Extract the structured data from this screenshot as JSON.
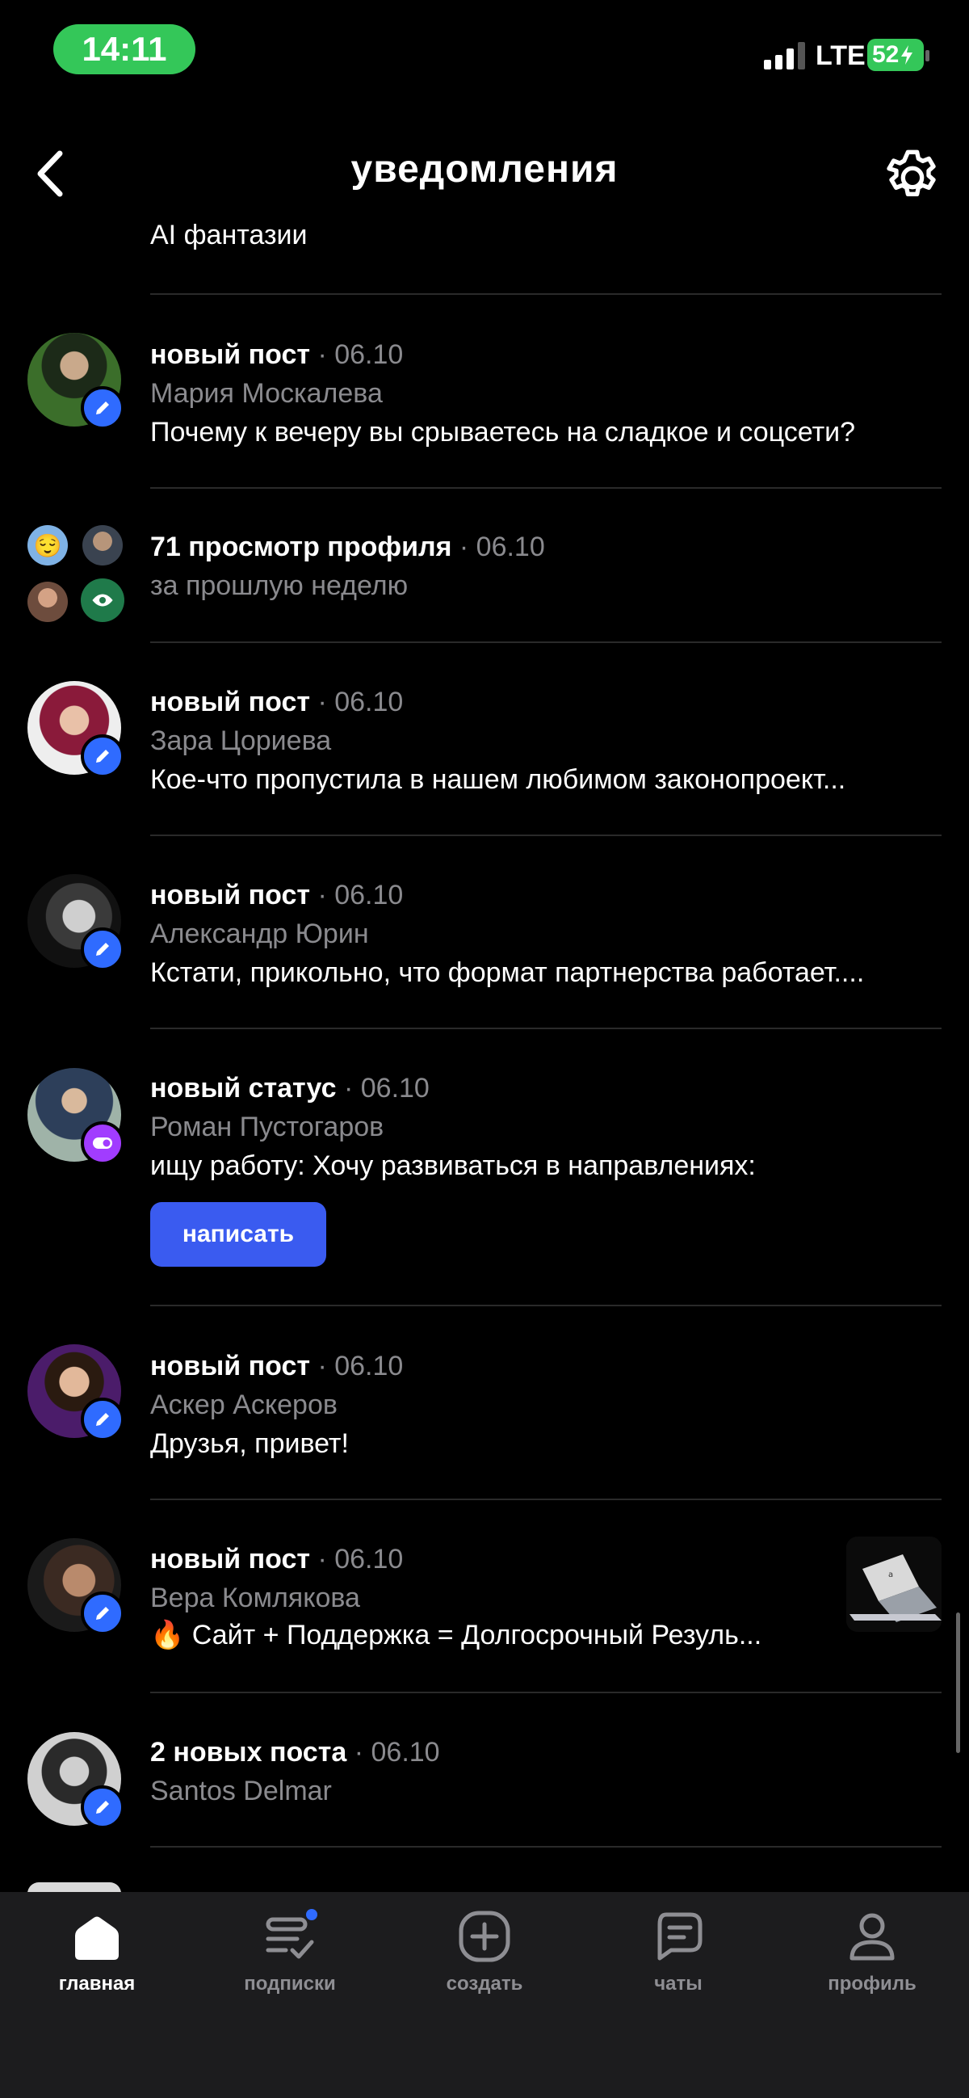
{
  "status_bar": {
    "time": "14:11",
    "network": "LTE",
    "battery": "52"
  },
  "header": {
    "title": "уведомления"
  },
  "cut_item": {
    "text": "AI  фантазии"
  },
  "items": [
    {
      "type": "новый пост",
      "date": "06.10",
      "name": "Мария Москалева",
      "text": "Почему к вечеру вы срываетесь на сладкое и соцсети?",
      "badge_icon": "pencil-icon"
    },
    {
      "type": "71 просмотр профиля",
      "date": "06.10",
      "name": "за прошлую неделю",
      "badge_icon": "eye-icon"
    },
    {
      "type": "новый пост",
      "date": "06.10",
      "name": "Зара Цориева",
      "text": "Кое-что пропустила в нашем любимом законопроект...",
      "badge_icon": "pencil-icon"
    },
    {
      "type": "новый пост",
      "date": "06.10",
      "name": "Александр Юрин",
      "text": "Кстати, прикольно, что формат партнерства работает....",
      "badge_icon": "pencil-icon"
    },
    {
      "type": "новый статус",
      "date": "06.10",
      "name": "Роман Пустогаров",
      "text": "ищу работу: Хочу развиваться в направлениях:",
      "badge_icon": "status-icon",
      "button": "написать"
    },
    {
      "type": "новый пост",
      "date": "06.10",
      "name": "Аскер Аскеров",
      "text": "Друзья, привет!",
      "badge_icon": "pencil-icon"
    },
    {
      "type": "новый пост",
      "date": "06.10",
      "name": "Вера Комлякова",
      "text": "Сайт + Поддержка = Долгосрочный Резуль...",
      "emoji": "🔥",
      "badge_icon": "pencil-icon"
    },
    {
      "type": "2 новых поста",
      "date": "06.10",
      "name": "Santos Delmar",
      "badge_icon": "pencil-icon"
    }
  ],
  "tabs": [
    {
      "label": "главная",
      "icon": "home-icon",
      "active": true
    },
    {
      "label": "подписки",
      "icon": "subscriptions-icon",
      "active": false
    },
    {
      "label": "создать",
      "icon": "create-icon",
      "active": false
    },
    {
      "label": "чаты",
      "icon": "chat-icon",
      "active": false
    },
    {
      "label": "профиль",
      "icon": "profile-icon",
      "active": false
    }
  ],
  "colors": {
    "accent": "#3a5bf0",
    "badge_blue": "#2f6bff",
    "badge_purple": "#a13cff",
    "status_green": "#34c759"
  }
}
